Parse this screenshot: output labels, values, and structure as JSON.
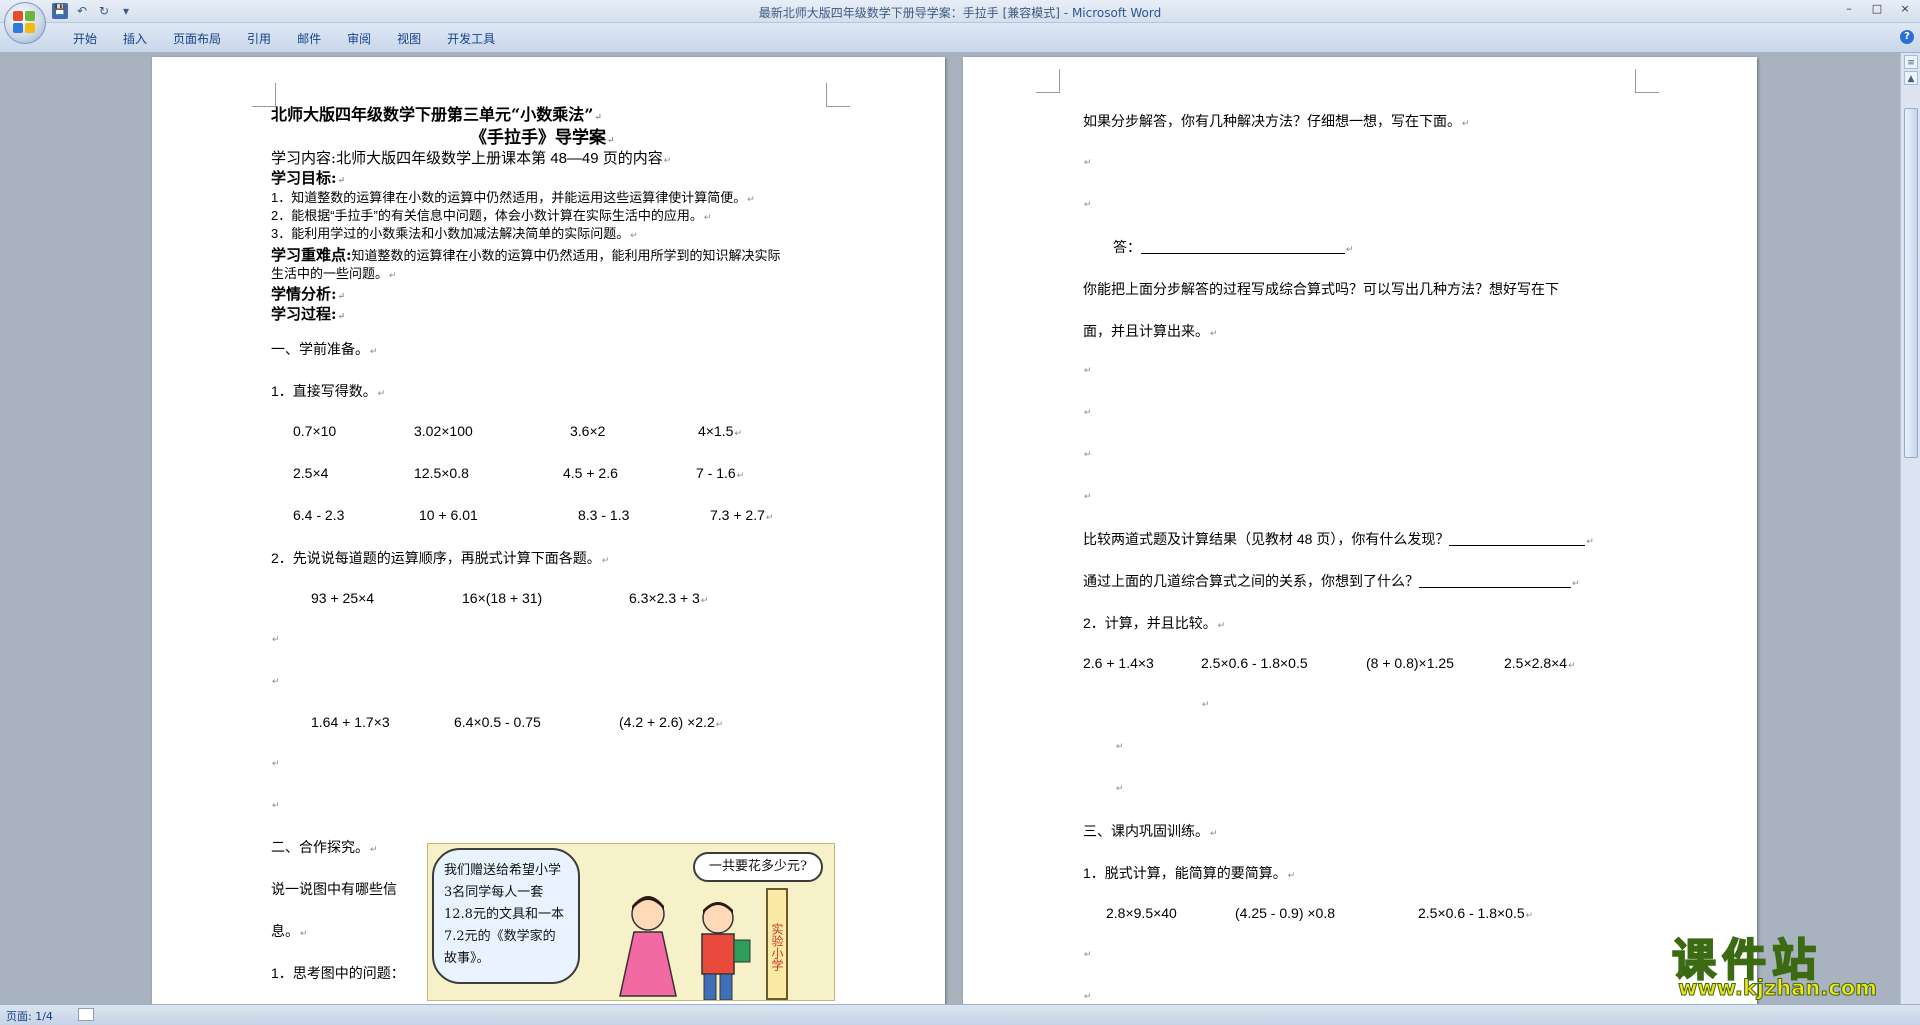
{
  "window": {
    "title": "最新北师大版四年级数学下册导学案：手拉手 [兼容模式]",
    "app_name": "Microsoft Word",
    "separator": " - ",
    "controls": [
      "–",
      "□",
      "×"
    ]
  },
  "quick_access": {
    "save": "💾",
    "undo": "↶",
    "redo": "↻",
    "more": "▾"
  },
  "ribbon": {
    "tabs": [
      "开始",
      "插入",
      "页面布局",
      "引用",
      "邮件",
      "审阅",
      "视图",
      "开发工具"
    ],
    "help": "?"
  },
  "status": {
    "page": "页面: 1/4"
  },
  "pm": "↵",
  "page1": {
    "title1": "北师大版四年级数学下册第三单元“小数乘法”",
    "title2": "《手拉手》导学案",
    "content_label": "学习内容:",
    "content_text": "北师大版四年级数学上册课本第 48—49 页的内容",
    "goals_label": "学习目标:",
    "goal1": "1．知道整数的运算律在小数的运算中仍然适用，并能运用这些运算律使计算简便。",
    "goal2": "2．能根据“手拉手”的有关信息中问题，体会小数计算在实际生活中的应用。",
    "goal3": "3．能利用学过的小数乘法和小数加减法解决简单的实际问题。",
    "key_label": "学习重难点:",
    "key_text": "知道整数的运算律在小数的运算中仍然适用，能利用所学到的知识解决实际",
    "key_text2": "生活中的一些问题。",
    "analysis_label": "学情分析:",
    "process_label": "学习过程:",
    "sec1": "一、学前准备。",
    "q1": "1．直接写得数。",
    "row1": [
      "0.7×10",
      "3.02×100",
      "3.6×2",
      "4×1.5"
    ],
    "row2": [
      "2.5×4",
      "12.5×0.8",
      "4.5 + 2.6",
      "7 - 1.6"
    ],
    "row3": [
      "6.4 - 2.3",
      "10 + 6.01",
      "8.3 - 1.3",
      "7.3 + 2.7"
    ],
    "q2": "2．先说说每道题的运算顺序，再脱式计算下面各题。",
    "row4": [
      "93 + 25×4",
      "16×(18 + 31)",
      "6.3×2.3 + 3"
    ],
    "row5": [
      "1.64 + 1.7×3",
      "6.4×0.5 - 0.75",
      "(4.2 + 2.6)  ×2.2"
    ],
    "sec2": "二、合作探究。",
    "discuss1": "说一说图中有哪些信",
    "discuss2": "息。",
    "think": "1．思考图中的问题：",
    "bubble": "我们赠送给希望小学3名同学每人一套12.8元的文具和一本7.2元的《数学家的故事》。",
    "bubble2": "一共要花多少元?",
    "sign": "实验小学"
  },
  "page2": {
    "p1": "如果分步解答，你有几种解决方法？仔细想一想，写在下面。",
    "answer_label": "答：",
    "p2a": "你能把上面分步解答的过程写成综合算式吗？可以写出几种方法？想好写在下",
    "p2b": "面，并且计算出来。",
    "p3": "比较两道式题及计算结果（见教材 48 页），你有什么发现？",
    "p4": "通过上面的几道综合算式之间的关系，你想到了什么？",
    "q2": "2．计算，并且比较。",
    "row1": [
      "2.6 + 1.4×3",
      "2.5×0.6 - 1.8×0.5",
      "(8 + 0.8)×1.25",
      "2.5×2.8×4"
    ],
    "sec3": "三、课内巩固训练。",
    "q3": "1．脱式计算，能简算的要简算。",
    "row2": [
      "2.8×9.5×40",
      "(4.25 - 0.9)  ×0.8",
      "2.5×0.6 - 1.8×0.5"
    ]
  },
  "watermark": {
    "brand": "课件站",
    "url": "www.kjzhan.com"
  }
}
